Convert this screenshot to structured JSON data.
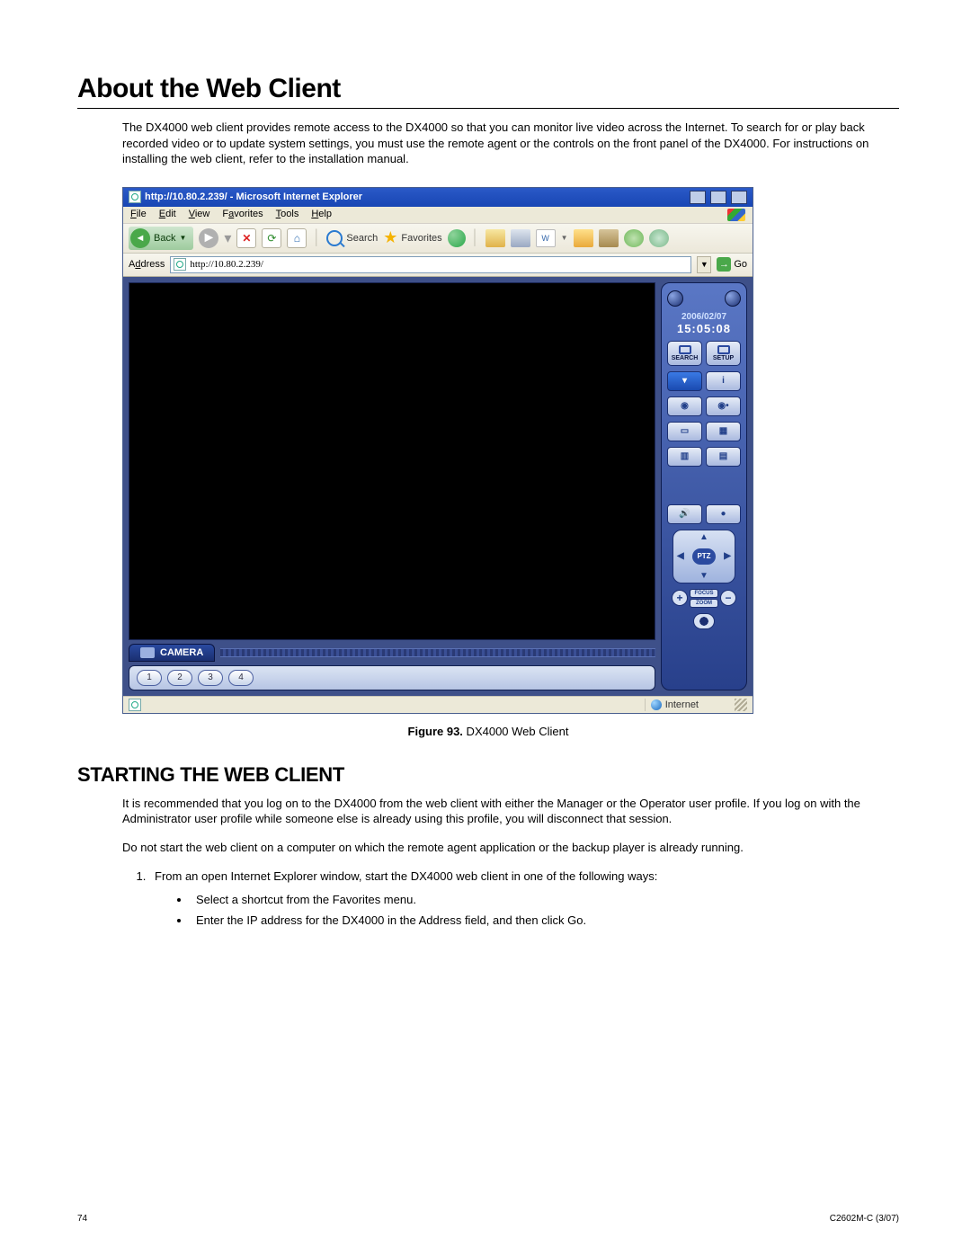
{
  "heading": "About the Web Client",
  "intro": "The DX4000 web client provides remote access to the DX4000 so that you can monitor live video across the Internet. To search for or play back recorded video or to update system settings, you must use the remote agent or the controls on the front panel of the DX4000. For instructions on installing the web client, refer to the installation manual.",
  "ie": {
    "title": "http://10.80.2.239/ - Microsoft Internet Explorer",
    "menus": {
      "file": "File",
      "edit": "Edit",
      "view": "View",
      "favorites": "Favorites",
      "tools": "Tools",
      "help": "Help"
    },
    "toolbar": {
      "back": "Back",
      "search": "Search",
      "favorites": "Favorites"
    },
    "address": {
      "label": "Address",
      "url": "http://10.80.2.239/",
      "go": "Go"
    },
    "status": {
      "zone": "Internet"
    }
  },
  "panel": {
    "date": "2006/02/07",
    "time": "15:05:08",
    "search": "SEARCH",
    "setup": "SETUP",
    "camera": "CAMERA",
    "cams": [
      "1",
      "2",
      "3",
      "4"
    ],
    "ptz": "PTZ",
    "focus": "FOCUS",
    "zoom": "ZOOM"
  },
  "caption": {
    "prefix": "Figure 93.",
    "text": "  DX4000 Web Client"
  },
  "subheading": "STARTING THE WEB CLIENT",
  "para1": "It is recommended that you log on to the DX4000 from the web client with either the Manager or the Operator user profile. If you log on with the Administrator user profile while someone else is already using this profile, you will disconnect that session.",
  "para2": "Do not start the web client on a computer on which the remote agent application or the backup player is already running.",
  "step1": "From an open Internet Explorer window, start the DX4000 web client in one of the following ways:",
  "bullet1": "Select a shortcut from the Favorites menu.",
  "bullet2": "Enter the IP address for the DX4000 in the Address field, and then click Go.",
  "footer": {
    "page": "74",
    "doc": "C2602M-C (3/07)"
  }
}
